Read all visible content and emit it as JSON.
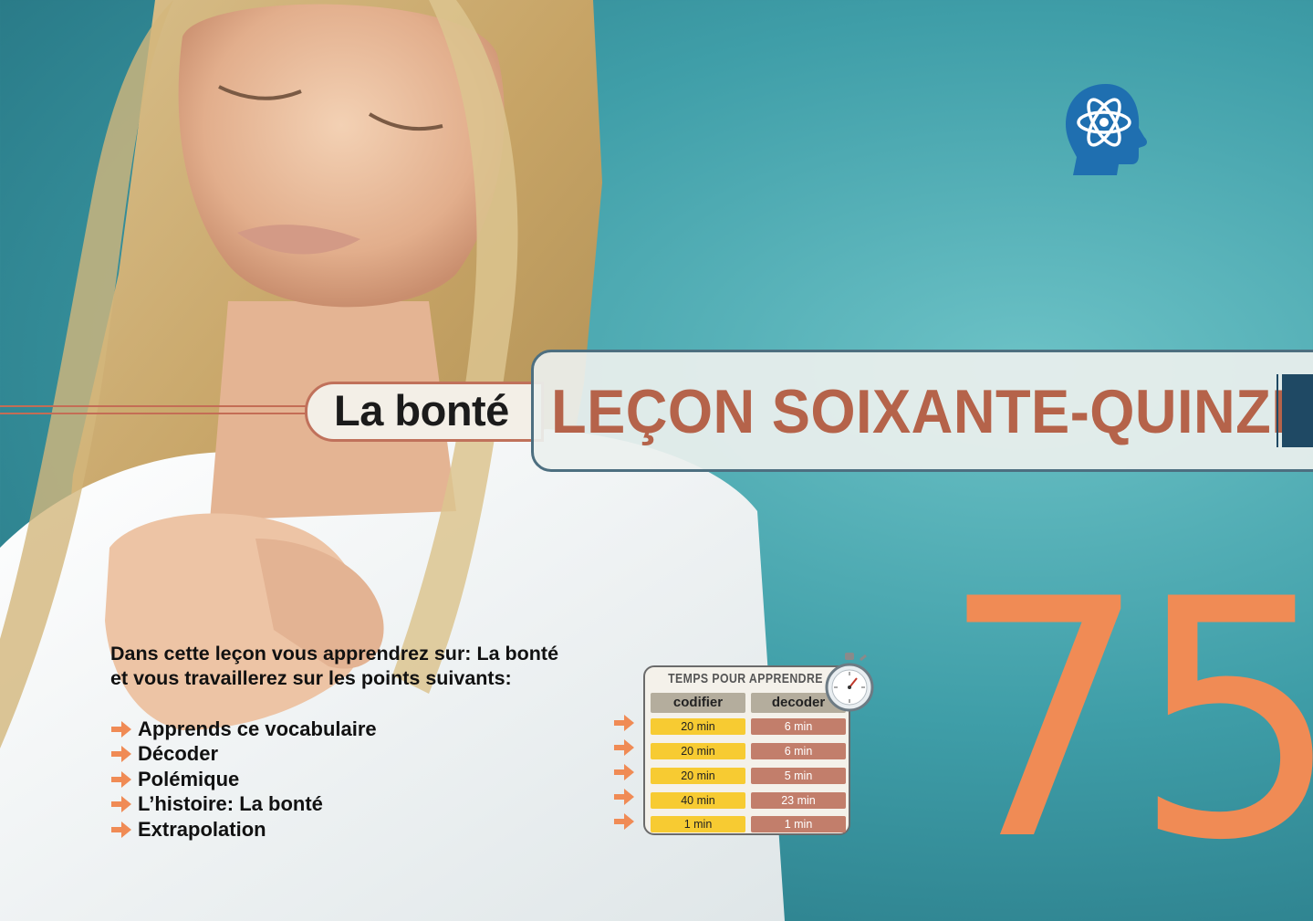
{
  "lesson": {
    "subtitle": "La bonté",
    "title": "LEÇON SOIXANTE-QUINZE",
    "number": "75"
  },
  "intro": {
    "line1": "Dans cette leçon vous apprendrez sur: La bonté",
    "line2": "et vous travaillerez sur les points suivants:"
  },
  "topics": [
    "Apprends ce vocabulaire",
    "Décoder",
    "Polémique",
    "L’histoire: La bonté",
    "Extrapolation"
  ],
  "time_panel": {
    "header": "TEMPS POUR APPRENDRE",
    "col1": "codifier",
    "col2": "decoder",
    "rows": [
      {
        "codifier": "20 min",
        "decoder": "6 min"
      },
      {
        "codifier": "20 min",
        "decoder": "6 min"
      },
      {
        "codifier": "20 min",
        "decoder": "5 min"
      },
      {
        "codifier": "40 min",
        "decoder": "23 min"
      },
      {
        "codifier": "1 min",
        "decoder": "1 min"
      }
    ]
  },
  "icons": [
    "brain-atom-icon",
    "arrow-right-icon",
    "stopwatch-icon"
  ],
  "colors": {
    "accent": "#b5634a",
    "number": "#f08b55",
    "codifier": "#f7cb32",
    "decoder": "#c27e6b",
    "background": "#3f9ea8"
  }
}
